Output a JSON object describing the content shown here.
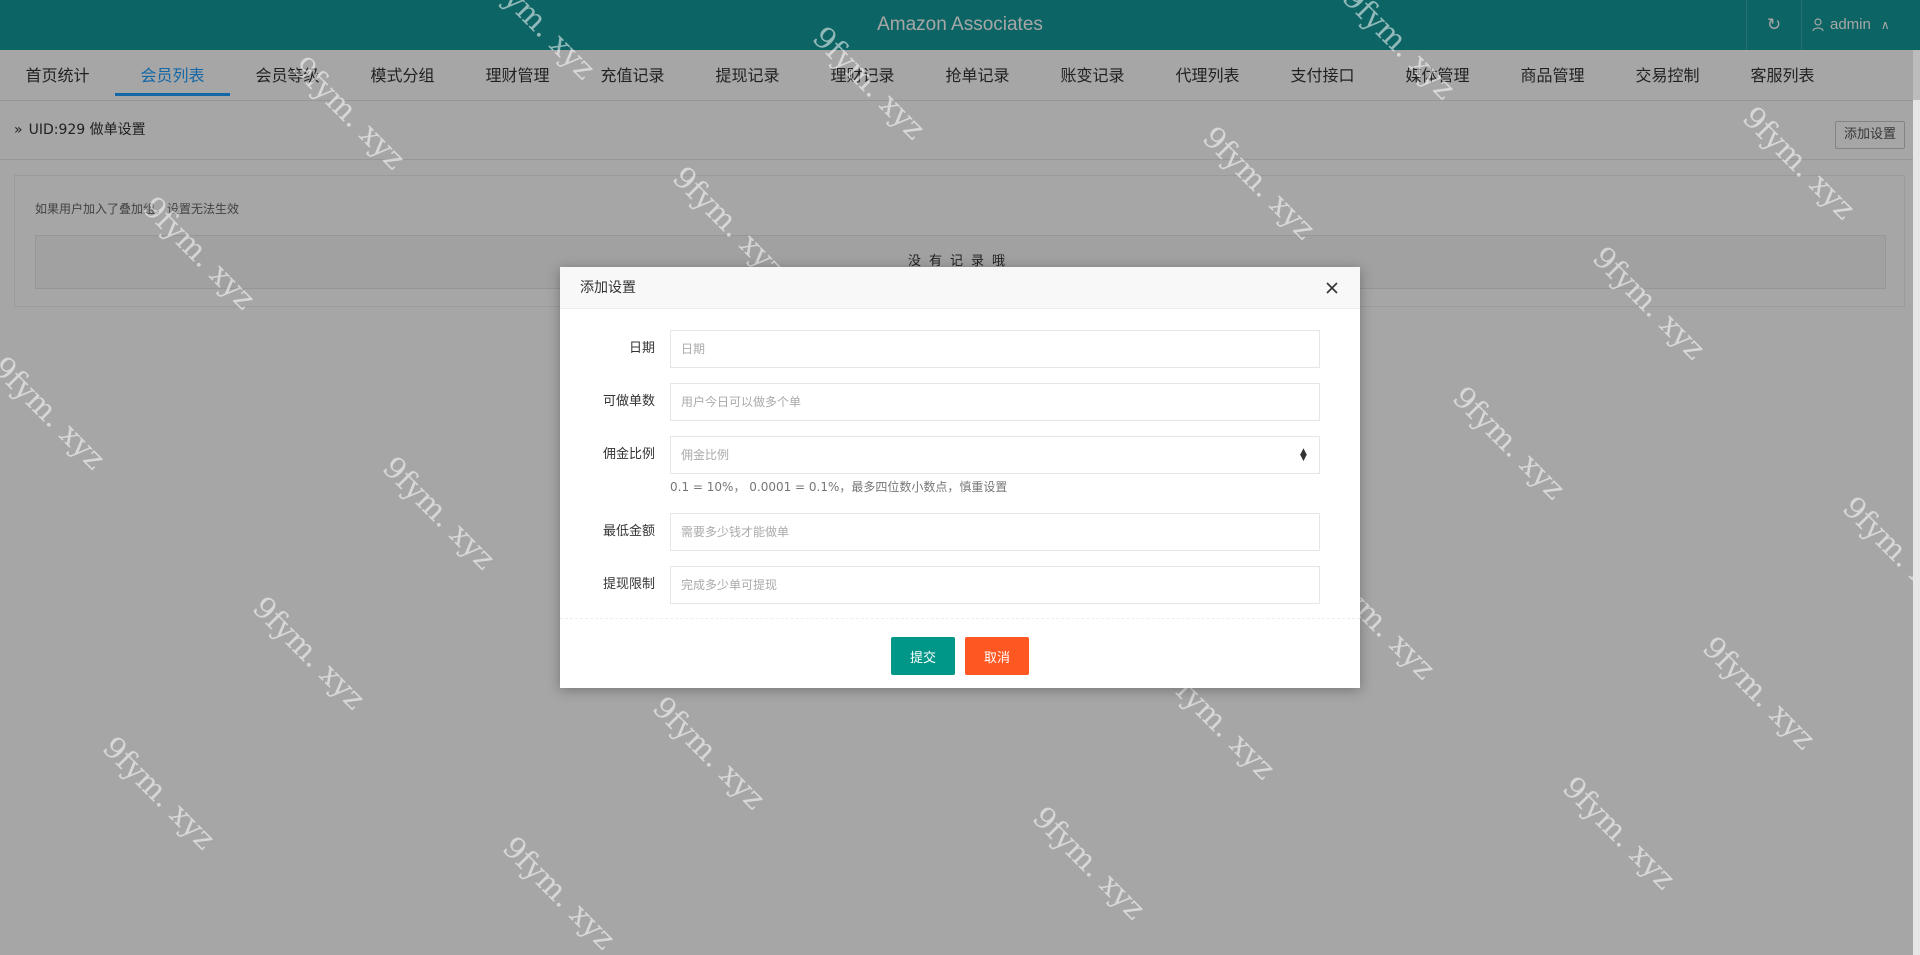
{
  "header": {
    "title": "Amazon Associates",
    "user": "admin",
    "refresh_icon": "refresh-icon",
    "user_icon": "user-icon"
  },
  "nav": {
    "tabs": [
      {
        "label": "首页统计"
      },
      {
        "label": "会员列表",
        "active": true
      },
      {
        "label": "会员等级"
      },
      {
        "label": "模式分组"
      },
      {
        "label": "理财管理"
      },
      {
        "label": "充值记录"
      },
      {
        "label": "提现记录"
      },
      {
        "label": "理财记录"
      },
      {
        "label": "抢单记录"
      },
      {
        "label": "账变记录"
      },
      {
        "label": "代理列表"
      },
      {
        "label": "支付接口"
      },
      {
        "label": "媒体管理"
      },
      {
        "label": "商品管理"
      },
      {
        "label": "交易控制"
      },
      {
        "label": "客服列表"
      }
    ]
  },
  "breadcrumb": {
    "text": "UID:929 做单设置"
  },
  "toolbar": {
    "add_label": "添加设置"
  },
  "panel": {
    "tip": "如果用户加入了叠加组，设置无法生效",
    "empty": "没有记录哦"
  },
  "dialog": {
    "title": "添加设置",
    "fields": {
      "date": {
        "label": "日期",
        "placeholder": "日期"
      },
      "count": {
        "label": "可做单数",
        "placeholder": "用户今日可以做多个单"
      },
      "ratio": {
        "label": "佣金比例",
        "placeholder": "佣金比例",
        "help": "0.1 = 10%， 0.0001 = 0.1%，最多四位数小数点，慎重设置"
      },
      "min_amount": {
        "label": "最低金额",
        "placeholder": "需要多少钱才能做单"
      },
      "withdraw_limit": {
        "label": "提现限制",
        "placeholder": "完成多少单可提现"
      }
    },
    "submit_label": "提交",
    "cancel_label": "取消"
  },
  "watermark": "9fym. xyz",
  "colors": {
    "topbar": "#159a9c",
    "accent": "#1e9fff",
    "submit": "#009688",
    "cancel": "#ff5722"
  }
}
